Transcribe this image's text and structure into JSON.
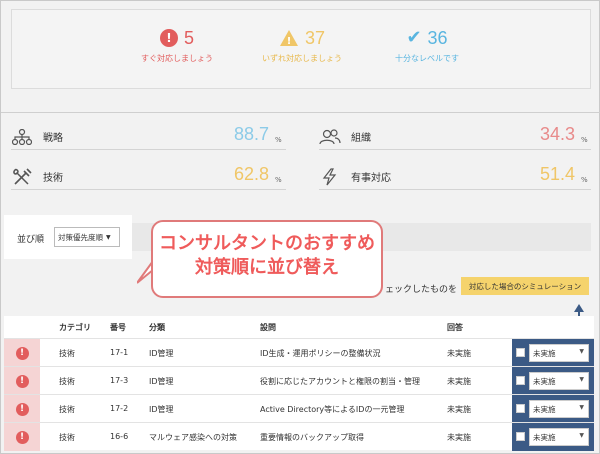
{
  "summary": {
    "urgent": {
      "count": "5",
      "label": "すぐ対応しましょう",
      "color": "#e25d5d",
      "icon": "exclamation-circle-icon"
    },
    "later": {
      "count": "37",
      "label": "いずれ対応しましょう",
      "color": "#f0c667",
      "icon": "warning-triangle-icon"
    },
    "ok": {
      "count": "36",
      "label": "十分なレベルです",
      "color": "#59b5e0",
      "icon": "check-icon"
    }
  },
  "metrics": {
    "strategy": {
      "label": "戦略",
      "value": "88.7",
      "unit": "%",
      "color": "#8ccbe8",
      "icon": "hierarchy-icon"
    },
    "organization": {
      "label": "組織",
      "value": "34.3",
      "unit": "%",
      "color": "#e88a8a",
      "icon": "people-icon"
    },
    "technology": {
      "label": "技術",
      "value": "62.8",
      "unit": "%",
      "color": "#f0c667",
      "icon": "tools-icon"
    },
    "incident": {
      "label": "有事対応",
      "value": "51.4",
      "unit": "%",
      "color": "#f0c667",
      "icon": "lightning-icon"
    }
  },
  "sort": {
    "label": "並び順",
    "selected": "対策優先度順"
  },
  "callout": {
    "line1": "コンサルタントのおすすめ",
    "line2": "対策順に並び替え"
  },
  "simulation": {
    "instruction": "ェックしたものを",
    "button": "対応した場合のシミュレーション"
  },
  "table": {
    "headers": {
      "category": "カテゴリ",
      "number": "番号",
      "classification": "分類",
      "question": "設問",
      "answer": "回答"
    },
    "rows": [
      {
        "category": "技術",
        "number": "17-1",
        "classification": "ID管理",
        "question": "ID生成・運用ポリシーの整備状況",
        "answer": "未実施",
        "status": "未実施"
      },
      {
        "category": "技術",
        "number": "17-3",
        "classification": "ID管理",
        "question": "役割に応じたアカウントと権限の割当・管理",
        "answer": "未実施",
        "status": "未実施"
      },
      {
        "category": "技術",
        "number": "17-2",
        "classification": "ID管理",
        "question": "Active Directory等によるIDの一元管理",
        "answer": "未実施",
        "status": "未実施"
      },
      {
        "category": "技術",
        "number": "16-6",
        "classification": "マルウェア感染への対策",
        "question": "重要情報のバックアップ取得",
        "answer": "未実施",
        "status": "未実施"
      }
    ]
  }
}
